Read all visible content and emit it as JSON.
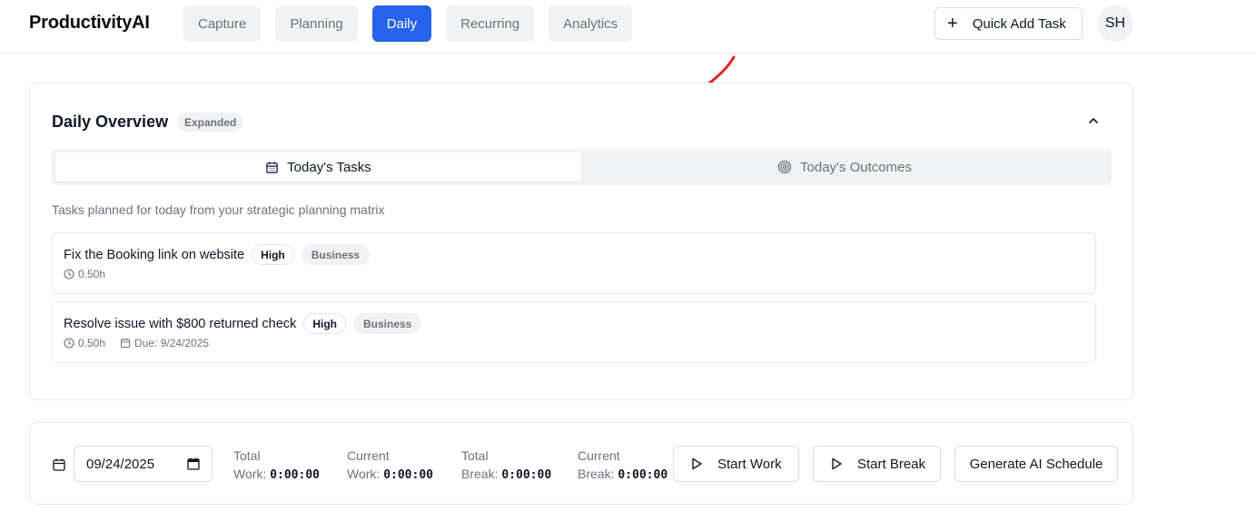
{
  "app": {
    "brand": "ProductivityAI",
    "nav": [
      "Capture",
      "Planning",
      "Daily",
      "Recurring",
      "Analytics"
    ],
    "active_nav": "Daily",
    "quick_add_label": "Quick Add Task",
    "avatar_initials": "SH",
    "accent_color": "#2563eb",
    "annotation_color": "#e02424"
  },
  "overview": {
    "title": "Daily Overview",
    "badge": "Expanded",
    "tabs": [
      {
        "label": "Today's Tasks",
        "icon": "calendar-icon",
        "active": true
      },
      {
        "label": "Today's Outcomes",
        "icon": "target-icon",
        "active": false
      }
    ],
    "subtitle": "Tasks planned for today from your strategic planning matrix",
    "tasks": [
      {
        "title": "Fix the Booking link on website",
        "priority": "High",
        "category": "Business",
        "duration": "0.50h",
        "due": null
      },
      {
        "title": "Resolve issue with $800 returned check",
        "priority": "High",
        "category": "Business",
        "duration": "0.50h",
        "due": "Due: 9/24/2025"
      }
    ]
  },
  "timer": {
    "date_value": "09/24/2025",
    "stats": [
      {
        "label1": "Total",
        "label2": "Work:",
        "value": "0:00:00"
      },
      {
        "label1": "Current",
        "label2": "Work:",
        "value": "0:00:00"
      },
      {
        "label1": "Total",
        "label2": "Break:",
        "value": "0:00:00"
      },
      {
        "label1": "Current",
        "label2": "Break:",
        "value": "0:00:00"
      }
    ],
    "start_work_label": "Start Work",
    "start_break_label": "Start Break",
    "generate_label": "Generate AI Schedule"
  }
}
